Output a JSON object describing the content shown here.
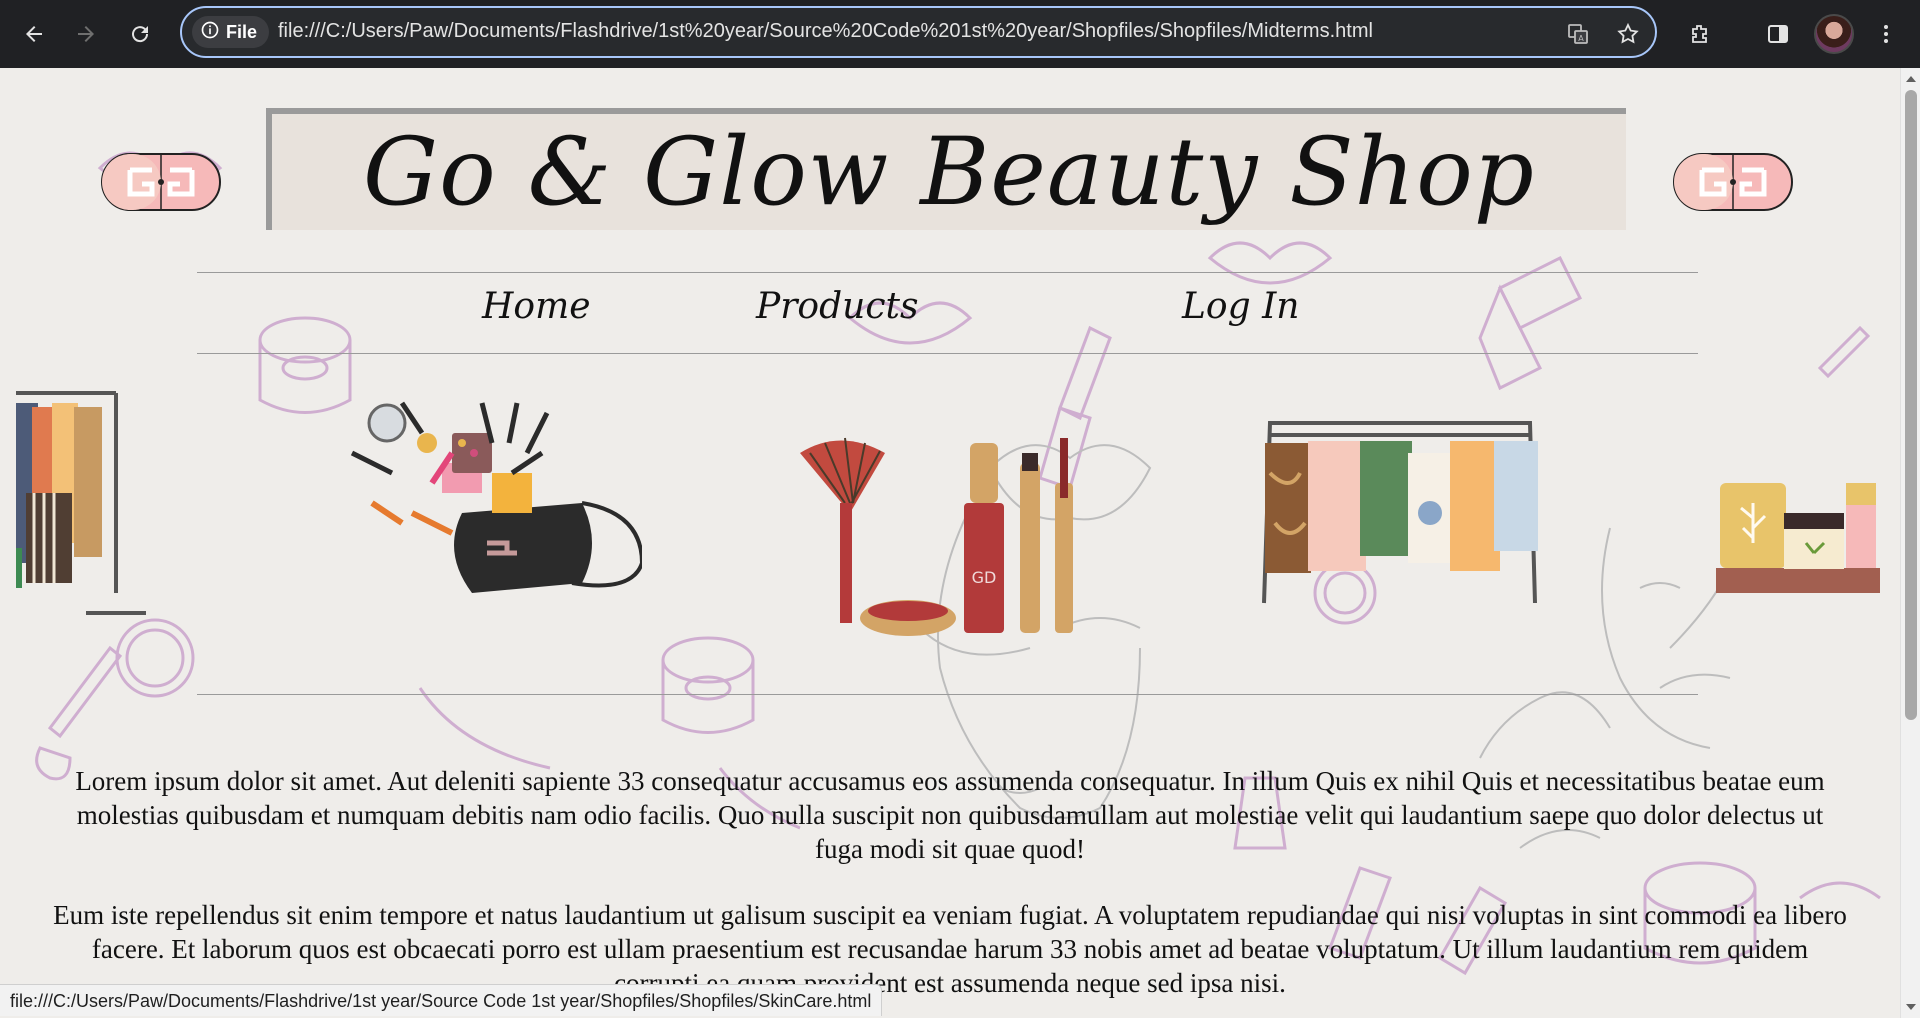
{
  "browser": {
    "chip_label": "File",
    "url": "file:///C:/Users/Paw/Documents/Flashdrive/1st%20year/Source%20Code%201st%20year/Shopfiles/Shopfiles/Midterms.html",
    "status_url": "file:///C:/Users/Paw/Documents/Flashdrive/1st year/Source Code 1st year/Shopfiles/Shopfiles/SkinCare.html",
    "icons": [
      "back-icon",
      "forward-icon",
      "reload-icon",
      "info-icon",
      "translate-icon",
      "bookmark-star-icon",
      "extensions-icon",
      "side-panel-icon",
      "profile-avatar",
      "menu-icon"
    ]
  },
  "site": {
    "title": "Go & Glow Beauty Shop",
    "logo_text": "GG",
    "nav": [
      {
        "label": "Home"
      },
      {
        "label": "Products"
      },
      {
        "label": "Log In"
      }
    ],
    "products": [
      {
        "name": "clothing-rack-partial"
      },
      {
        "name": "makeup-bag"
      },
      {
        "name": "brush-and-cosmetics"
      },
      {
        "name": "clothing-rack"
      },
      {
        "name": "skincare-shelf"
      }
    ],
    "paragraphs": [
      "Lorem ipsum dolor sit amet. Aut deleniti sapiente 33 consequatur accusamus eos assumenda consequatur. In illum Quis ex nihil Quis et necessitatibus beatae eum molestias quibusdam et numquam debitis nam odio facilis. Quo nulla suscipit non quibusdamullam aut molestiae velit qui laudantium saepe quo dolor delectus ut fuga modi sit quae quod!",
      "Eum iste repellendus sit enim tempore et natus laudantium ut galisum suscipit ea veniam fugiat. A voluptatem repudiandae qui nisi voluptas in sint commodi ea libero facere. Et laborum quos est obcaecati porro est ullam praesentium est recusandae harum 33 nobis amet ad beatae voluptatum. Ut illum laudantium rem quidem corrupti ea quam provident est assumenda neque sed ipsa nisi."
    ]
  },
  "colors": {
    "chrome_bg": "#202124",
    "omnibox_border": "#a8c7fa",
    "page_bg": "#efedea",
    "banner_bg": "#e8e2dc",
    "doodle": "#c9a3c9",
    "logo_pink": "#f6b9b9"
  }
}
